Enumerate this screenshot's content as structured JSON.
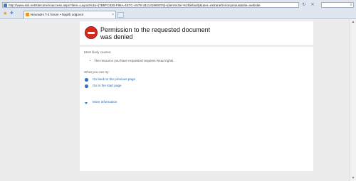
{
  "browser": {
    "url": "http://www.siol.net/sitecore/noaccess.aspx?item=Layout%3a+{7B5FC830-F96A-4E7C-A578-341141960076}+(item%3a+%2fdefault)&user=extranet\\Anonymous&site=website",
    "tab_title": "Neuradni T-2 forum • Napiši odgovor",
    "tab_close": "×"
  },
  "page": {
    "title_line1": "Permission to the requested document",
    "title_line2": "was denied",
    "causes_label": "Most likely causes:",
    "cause_1": "The resource you have requested requires Read rights.",
    "try_label": "What you can try:",
    "link_back": "Go back to the previous page",
    "link_start": "Go to the start page",
    "more_info": "More information"
  },
  "colors": {
    "error_icon": "#d32a22",
    "link": "#2166b3"
  }
}
